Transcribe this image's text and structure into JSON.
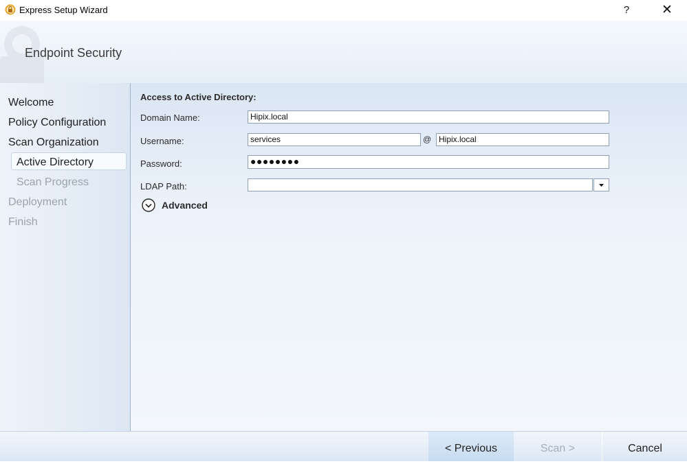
{
  "window": {
    "title": "Express Setup Wizard",
    "help_label": "?",
    "close_label": "✕"
  },
  "header": {
    "title": "Endpoint Security"
  },
  "sidebar": {
    "items": [
      {
        "label": "Welcome",
        "state": "done"
      },
      {
        "label": "Policy Configuration",
        "state": "done"
      },
      {
        "label": "Scan Organization",
        "state": "done"
      },
      {
        "label": "Active Directory",
        "state": "current"
      },
      {
        "label": "Scan Progress",
        "state": "disabled"
      },
      {
        "label": "Deployment",
        "state": "disabled"
      },
      {
        "label": "Finish",
        "state": "disabled"
      }
    ]
  },
  "form": {
    "section_title": "Access to Active Directory:",
    "domain": {
      "label": "Domain Name:",
      "value": "Hipix.local"
    },
    "username": {
      "label": "Username:",
      "value": "services",
      "at": "@",
      "domain_value": "Hipix.local"
    },
    "password": {
      "label": "Password:",
      "masked": "●●●●●●●●"
    },
    "ldap": {
      "label": "LDAP Path:",
      "value": ""
    },
    "advanced_label": "Advanced"
  },
  "footer": {
    "previous": "< Previous",
    "scan": "Scan >",
    "cancel": "Cancel"
  },
  "colors": {
    "accent_selected_button": "#c8dcf1",
    "sidebar_border": "#9fb4cd",
    "disabled_text": "#9ba3ad"
  },
  "icons": {
    "app": "endpoint-security-app-icon",
    "advanced": "chevron-down-circle-icon",
    "dropdown": "caret-down-icon"
  }
}
